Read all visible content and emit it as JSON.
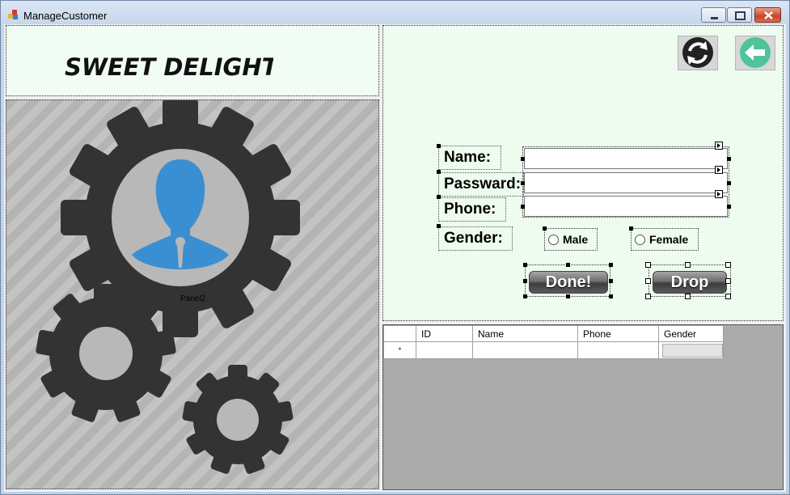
{
  "window": {
    "title": "ManageCustomer"
  },
  "header": {
    "brand": "SWEET DELIGHTS"
  },
  "image_panel": {
    "label": "Panel2"
  },
  "form": {
    "name_label": "Name:",
    "password_label": "Passward:",
    "phone_label": "Phone:",
    "gender_label": "Gender:",
    "name_value": "",
    "password_value": "",
    "phone_value": "",
    "male_label": "Male",
    "female_label": "Female",
    "done_label": "Done!",
    "drop_label": "Drop"
  },
  "grid": {
    "columns": [
      "ID",
      "Name",
      "Phone",
      "Gender"
    ],
    "new_row_marker": "*"
  },
  "colors": {
    "form_bg": "#edfcee",
    "user_icon": "#3a8fd2",
    "gear": "#333333",
    "back_icon": "#4fc39a"
  }
}
